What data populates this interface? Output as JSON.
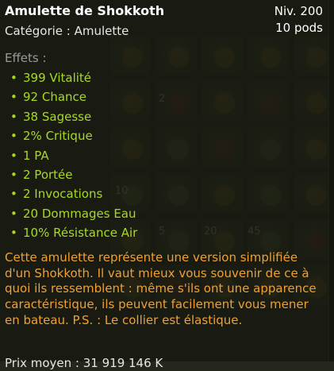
{
  "item": {
    "name": "Amulette de Shokkoth",
    "category": "Catégorie : Amulette",
    "level": "Niv. 200",
    "weight": "10 pods"
  },
  "effects": {
    "title": "Effets :",
    "bullet": "•",
    "items": [
      "399 Vitalité",
      "92 Chance",
      "38 Sagesse",
      "2% Critique",
      "1 PA",
      "2 Portée",
      "2 Invocations",
      "20 Dommages Eau",
      "10% Résistance Air"
    ]
  },
  "description": "Cette amulette représente une version simplifiée d'un Shokkoth. Il vaut mieux vous souvenir de ce à quoi ils ressemblent : même s'ils ont une apparence caractéristique, ils peuvent facilement vous mener en bateau. P.S. : Le collier est élastique.",
  "background_numbers": [
    "2",
    "10",
    "5",
    "20",
    "45"
  ],
  "footer_partial": "Prix moyen : 31 919 146 K",
  "colors": {
    "effect_green": "#a7d923",
    "description_orange": "#f0a030",
    "title_white": "#ffffff",
    "label_grey": "#9a9a9a"
  }
}
